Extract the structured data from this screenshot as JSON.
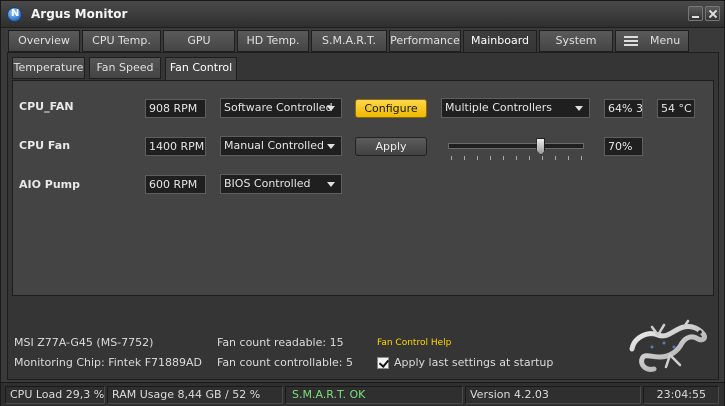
{
  "window": {
    "title": "Argus Monitor"
  },
  "main_tabs": [
    {
      "label": "Overview"
    },
    {
      "label": "CPU Temp."
    },
    {
      "label": "GPU"
    },
    {
      "label": "HD Temp."
    },
    {
      "label": "S.M.A.R.T."
    },
    {
      "label": "Performance"
    },
    {
      "label": "Mainboard",
      "active": true
    },
    {
      "label": "System"
    },
    {
      "label": "Menu",
      "icon": "hamburger-icon"
    }
  ],
  "sub_tabs": [
    {
      "label": "Temperature"
    },
    {
      "label": "Fan Speed"
    },
    {
      "label": "Fan Control",
      "active": true
    }
  ],
  "fans": [
    {
      "name": "CPU_FAN",
      "rpm": "908 RPM",
      "mode": "Software Controlled",
      "action": "Configure",
      "controller": "Multiple Controllers",
      "percent": "64% 3",
      "temp": "54 °C"
    },
    {
      "name": "CPU Fan",
      "rpm": "1400 RPM",
      "mode": "Manual Controlled",
      "action": "Apply",
      "slider_value": 0.7,
      "percent": "70%"
    },
    {
      "name": "AIO Pump",
      "rpm": "600 RPM",
      "mode": "BIOS Controlled"
    }
  ],
  "info": {
    "board": "MSI Z77A-G45 (MS-7752)",
    "chip": "Monitoring Chip: Fintek F71889AD",
    "fan_readable": "Fan count readable: 15",
    "fan_controllable": "Fan count controllable: 5",
    "help_link": "Fan Control Help",
    "apply_last": "Apply last settings at startup",
    "apply_last_checked": true
  },
  "status_bar": {
    "cpu_load": "CPU Load 29,3 %",
    "ram_usage": "RAM Usage 8,44 GB / 52 %",
    "smart": "S.M.A.R.T. OK",
    "version": "Version 4.2.03",
    "time": "23:04:55"
  },
  "colors": {
    "accent_button": "#f0c000",
    "smart_ok": "#7de07d",
    "help_link": "#ffd700"
  }
}
